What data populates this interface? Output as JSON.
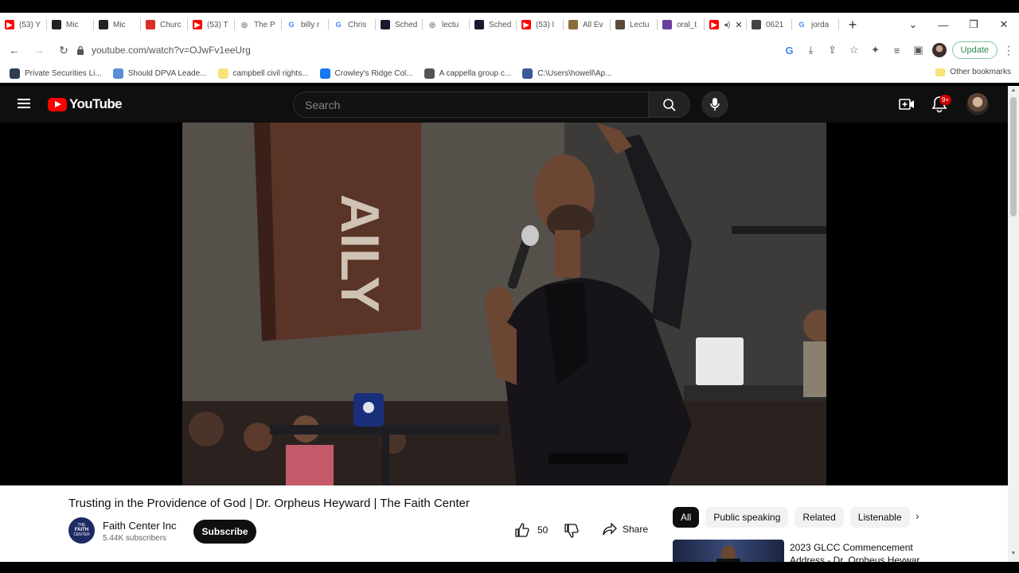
{
  "browser": {
    "tabs": [
      {
        "label": "(53) Y",
        "icon": "youtube-icon",
        "color": "#ff0000"
      },
      {
        "label": "Mic",
        "icon": "mic-brand-icon",
        "color": "#222222"
      },
      {
        "label": "Mic",
        "icon": "bdg-brand-icon",
        "color": "#222222"
      },
      {
        "label": "Churc",
        "icon": "church-icon",
        "color": "#d93025"
      },
      {
        "label": "(53) T",
        "icon": "youtube-icon",
        "color": "#ff0000"
      },
      {
        "label": "The P",
        "icon": "globe-icon",
        "color": "#777777"
      },
      {
        "label": "billy r",
        "icon": "google-icon",
        "color": "#4285f4"
      },
      {
        "label": "Chris",
        "icon": "google-icon",
        "color": "#4285f4"
      },
      {
        "label": "Sched",
        "icon": "schedule-icon",
        "color": "#1a1a2e"
      },
      {
        "label": "lectu",
        "icon": "globe-icon",
        "color": "#777777"
      },
      {
        "label": "Sched",
        "icon": "schedule-icon",
        "color": "#1a1a2e"
      },
      {
        "label": "(53) I",
        "icon": "youtube-icon",
        "color": "#ff0000"
      },
      {
        "label": "All Ev",
        "icon": "building-icon",
        "color": "#8a6d3b"
      },
      {
        "label": "Lectu",
        "icon": "person-icon",
        "color": "#5a4a3a"
      },
      {
        "label": "oral_t",
        "icon": "chart-icon",
        "color": "#6b3fa0"
      },
      {
        "label": "",
        "icon": "youtube-icon",
        "color": "#ff0000",
        "audio": "◂)"
      },
      {
        "label": "0621",
        "icon": "photo-icon",
        "color": "#444444"
      },
      {
        "label": "jorda",
        "icon": "google-icon",
        "color": "#4285f4"
      }
    ],
    "url": "youtube.com/watch?v=OJwFv1eeUrg",
    "update_label": "Update",
    "bookmarks": [
      {
        "label": "Private Securities Li...",
        "color": "#2c3e50"
      },
      {
        "label": "Should DPVA Leade...",
        "color": "#5a8fd8"
      },
      {
        "label": "campbell civil rights...",
        "color": "#f7e37a"
      },
      {
        "label": "Crowley's Ridge Col...",
        "color": "#1877f2"
      },
      {
        "label": "A cappella group c...",
        "color": "#555555"
      },
      {
        "label": "C:\\Users\\howell\\Ap...",
        "color": "#3b5998"
      }
    ],
    "other_bookmarks": "Other bookmarks"
  },
  "youtube": {
    "logo_text": "YouTube",
    "search_placeholder": "Search",
    "notification_count": "9+",
    "video": {
      "title": "Trusting in the Providence of God | Dr. Orpheus Heyward | The Faith Center",
      "channel": "Faith Center Inc",
      "subscribers": "5.44K subscribers",
      "subscribe_label": "Subscribe",
      "likes": "50",
      "share_label": "Share",
      "channel_avatar_text": [
        "THE",
        "FAITH",
        "CENTER"
      ]
    },
    "chips": [
      "All",
      "Public speaking",
      "Related",
      "Listenable"
    ],
    "recommendation": {
      "title": "2023 GLCC Commencement Address - Dr. Orpheus Heywar"
    },
    "scene_banner_text": "AILY"
  }
}
